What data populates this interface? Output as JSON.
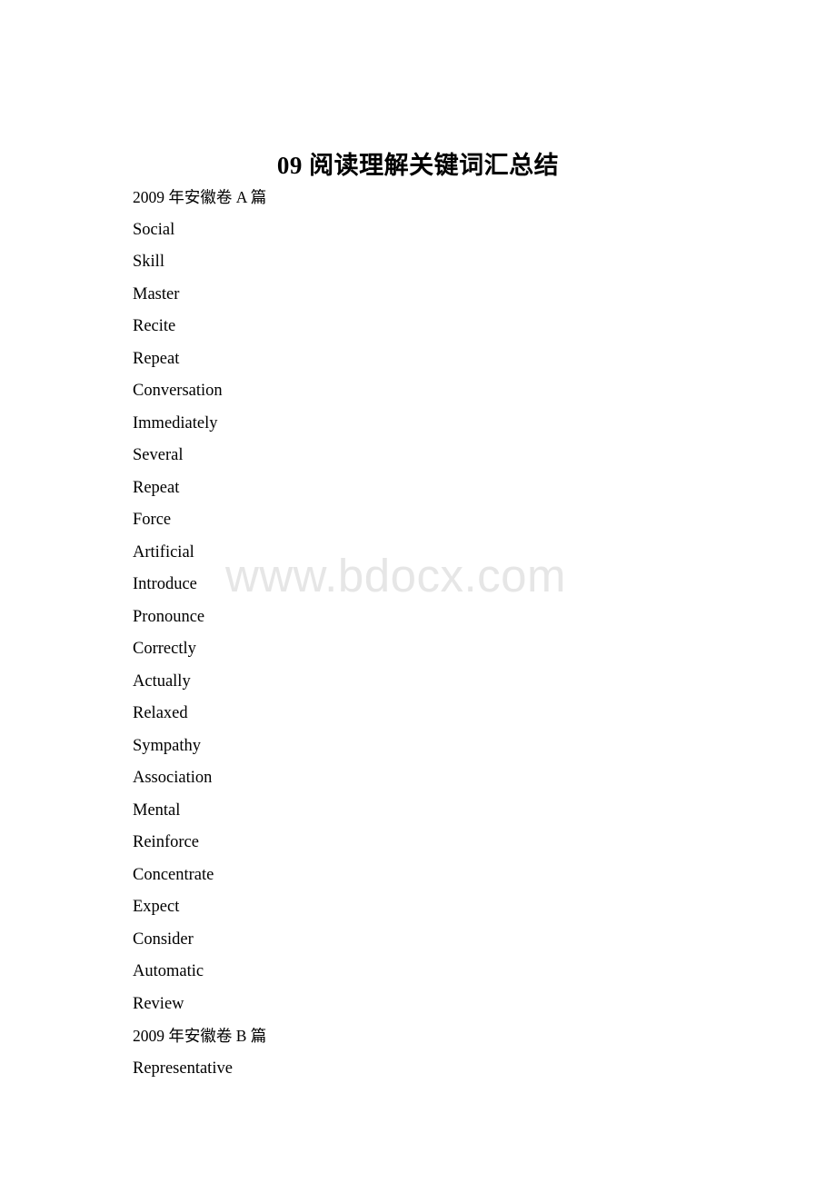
{
  "document": {
    "title": "09 阅读理解关键词汇总结",
    "watermark": "www.bdocx.com",
    "lines": [
      {
        "text": "2009 年安徽卷 A 篇",
        "type": "section-header"
      },
      {
        "text": "Social",
        "type": "word"
      },
      {
        "text": "Skill",
        "type": "word"
      },
      {
        "text": "Master",
        "type": "word"
      },
      {
        "text": "Recite",
        "type": "word"
      },
      {
        "text": "Repeat",
        "type": "word"
      },
      {
        "text": "Conversation",
        "type": "word"
      },
      {
        "text": "Immediately",
        "type": "word"
      },
      {
        "text": "Several",
        "type": "word"
      },
      {
        "text": "Repeat",
        "type": "word"
      },
      {
        "text": "Force",
        "type": "word"
      },
      {
        "text": "Artificial",
        "type": "word"
      },
      {
        "text": "Introduce",
        "type": "word"
      },
      {
        "text": "Pronounce",
        "type": "word"
      },
      {
        "text": "Correctly",
        "type": "word"
      },
      {
        "text": "Actually",
        "type": "word"
      },
      {
        "text": "Relaxed",
        "type": "word"
      },
      {
        "text": "Sympathy",
        "type": "word"
      },
      {
        "text": "Association",
        "type": "word"
      },
      {
        "text": "Mental",
        "type": "word"
      },
      {
        "text": "Reinforce",
        "type": "word"
      },
      {
        "text": "Concentrate",
        "type": "word"
      },
      {
        "text": "Expect",
        "type": "word"
      },
      {
        "text": "Consider",
        "type": "word"
      },
      {
        "text": "Automatic",
        "type": "word"
      },
      {
        "text": "Review",
        "type": "word"
      },
      {
        "text": "2009 年安徽卷 B 篇",
        "type": "section-header"
      },
      {
        "text": "Representative",
        "type": "word"
      }
    ]
  },
  "colors": {
    "text": "#000000",
    "watermark": "#e6e6e6",
    "background": "#ffffff"
  }
}
